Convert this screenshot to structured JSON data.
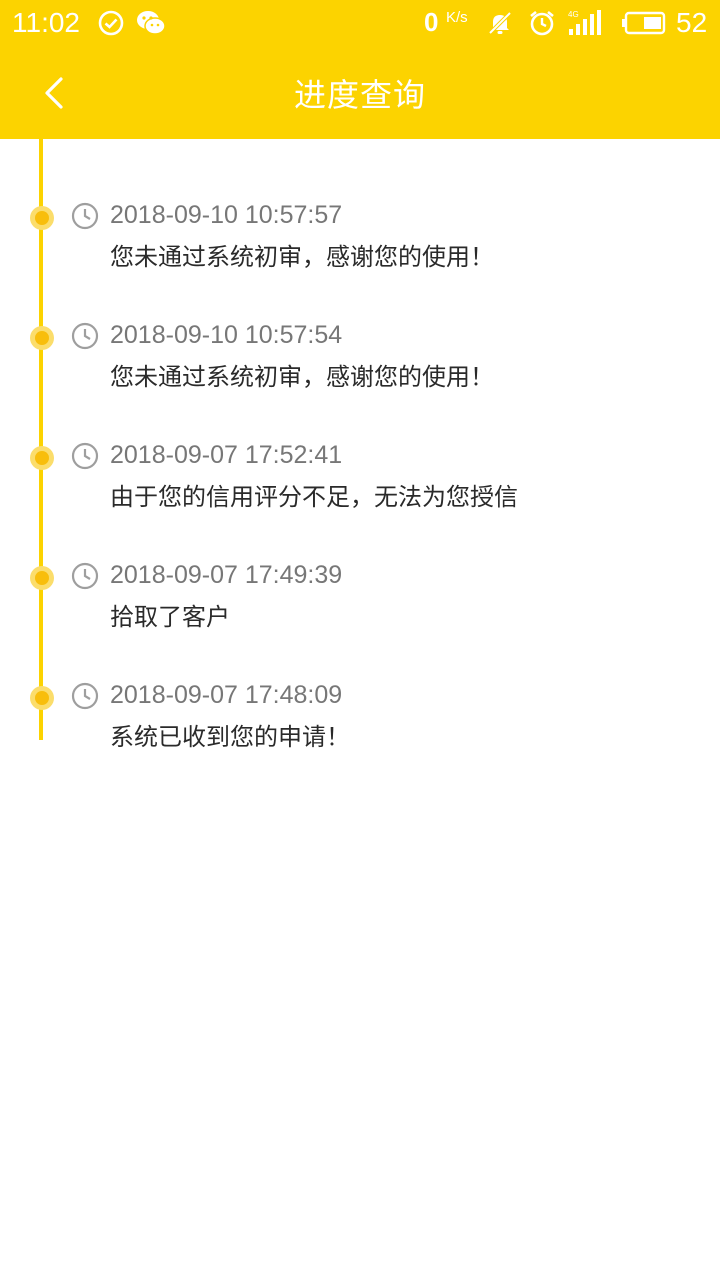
{
  "status_bar": {
    "time": "11:02",
    "net_speed": "0",
    "net_unit": "K/s",
    "battery": "52",
    "icons": [
      "check-circle-icon",
      "wechat-icon",
      "mute-icon",
      "alarm-icon",
      "signal-4g-icon",
      "battery-icon"
    ]
  },
  "header": {
    "title": "进度查询",
    "back_icon": "chevron-left-icon"
  },
  "colors": {
    "accent": "#FCD300",
    "dot": "#F8BE0C",
    "time_text": "#777777",
    "message_text": "#2a2a2a"
  },
  "timeline": [
    {
      "time": "2018-09-10 10:57:57",
      "message": "您未通过系统初审，感谢您的使用！"
    },
    {
      "time": "2018-09-10 10:57:54",
      "message": "您未通过系统初审，感谢您的使用！"
    },
    {
      "time": "2018-09-07 17:52:41",
      "message": "由于您的信用评分不足，无法为您授信"
    },
    {
      "time": "2018-09-07 17:49:39",
      "message": "拾取了客户"
    },
    {
      "time": "2018-09-07 17:48:09",
      "message": "系统已收到您的申请！"
    }
  ]
}
